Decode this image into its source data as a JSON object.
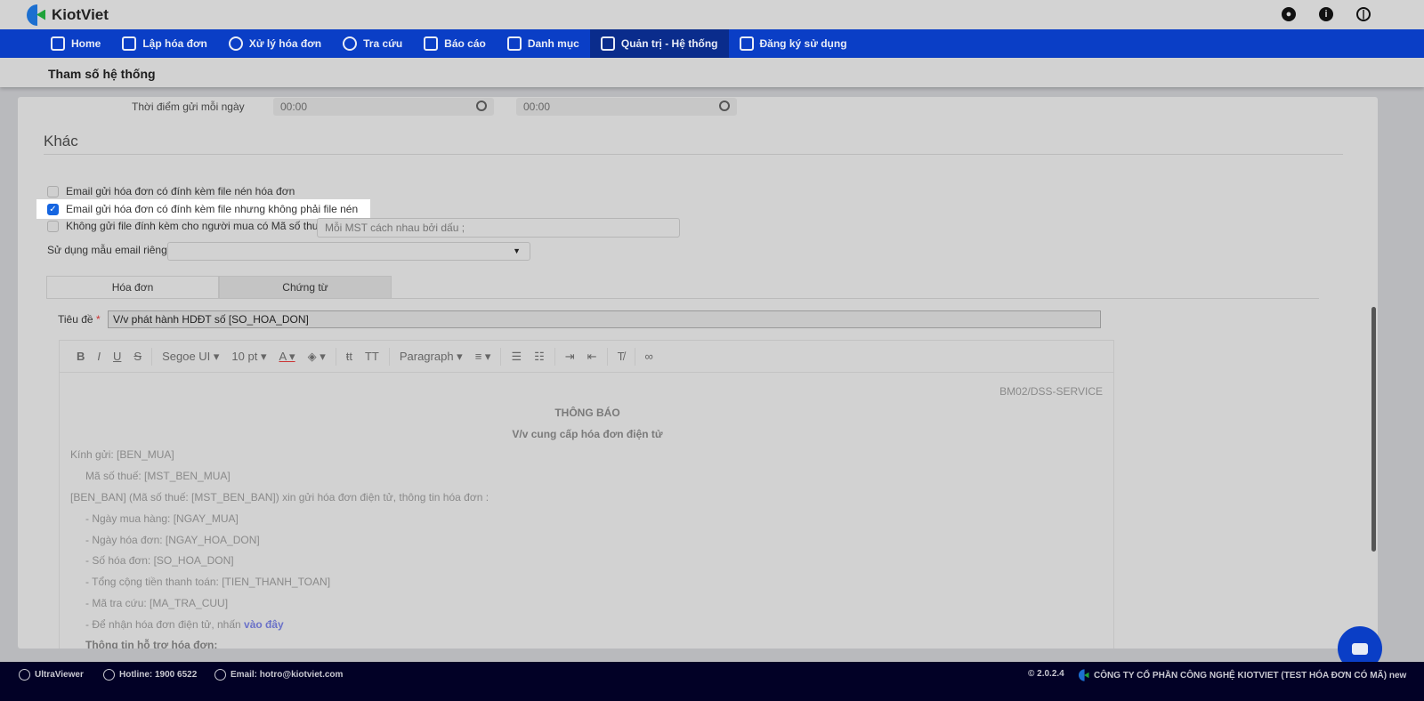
{
  "app": {
    "name": "KiotViet"
  },
  "topbar": {
    "icons": [
      "user-icon",
      "info-icon",
      "power-icon"
    ]
  },
  "nav": [
    {
      "label": "Home",
      "icon": "home-icon"
    },
    {
      "label": "Lập hóa đơn",
      "icon": "create-invoice-icon"
    },
    {
      "label": "Xử lý hóa đơn",
      "icon": "process-invoice-icon"
    },
    {
      "label": "Tra cứu",
      "icon": "search-icon"
    },
    {
      "label": "Báo cáo",
      "icon": "report-icon"
    },
    {
      "label": "Danh mục",
      "icon": "grid-icon"
    },
    {
      "label": "Quản trị - Hệ thống",
      "icon": "admin-icon",
      "active": true
    },
    {
      "label": "Đăng ký sử dụng",
      "icon": "register-icon"
    }
  ],
  "page_title": "Tham số hệ thống",
  "schedule": {
    "label": "Thời điểm gửi mỗi ngày",
    "time1": "00:00",
    "time2": "00:00"
  },
  "other": {
    "title": "Khác",
    "options": [
      {
        "label": "Email gửi hóa đơn có đính kèm file nén hóa đơn",
        "checked": false
      },
      {
        "label": "Email gửi hóa đơn có đính kèm file nhưng không phải file nén",
        "checked": true
      },
      {
        "label": "Không gửi file đính kèm cho người mua có Mã số thuế",
        "checked": false
      }
    ],
    "mst_placeholder": "Mỗi MST cách nhau bởi dấu ;",
    "template_label": "Sử dụng mẫu email riêng",
    "template_value": ""
  },
  "tabs": [
    "Hóa đơn",
    "Chứng từ"
  ],
  "subject": {
    "label": "Tiêu đề",
    "required": "*",
    "value": "V/v phát hành HDĐT số [SO_HOA_DON]"
  },
  "toolbar": {
    "font": "Segoe UI",
    "size": "10 pt",
    "block": "Paragraph"
  },
  "email_body": {
    "code": "BM02/DSS-SERVICE",
    "heading": "THÔNG BÁO",
    "subheading": "V/v cung cấp hóa đơn điện tử",
    "lines": [
      "Kính gửi: [BEN_MUA]",
      "Mã số thuế: [MST_BEN_MUA]",
      "[BEN_BAN] (Mã số thuế: [MST_BEN_BAN]) xin gửi hóa đơn điện tử, thông tin hóa đơn :",
      "- Ngày mua hàng: [NGAY_MUA]",
      "- Ngày hóa đơn: [NGAY_HOA_DON]",
      "- Số hóa đơn: [SO_HOA_DON]",
      "- Tổng cộng tiền thanh toán: [TIEN_THANH_TOAN]",
      "- Mã tra cứu: [MA_TRA_CUU]",
      "- Để nhận hóa đơn điện tử, nhấn "
    ],
    "link": "vào đây",
    "support": "Thông tin hỗ trợ hóa đơn:"
  },
  "footer": {
    "ultraviewer": "UltraViewer",
    "hotline": "Hotline: 1900 6522",
    "email": "Email: hotro@kiotviet.com",
    "version": "© 2.0.2.4",
    "company": "CÔNG TY CỔ PHẦN CÔNG NGHỆ KIOTVIET (TEST HÓA ĐƠN CÓ MÃ) new"
  }
}
